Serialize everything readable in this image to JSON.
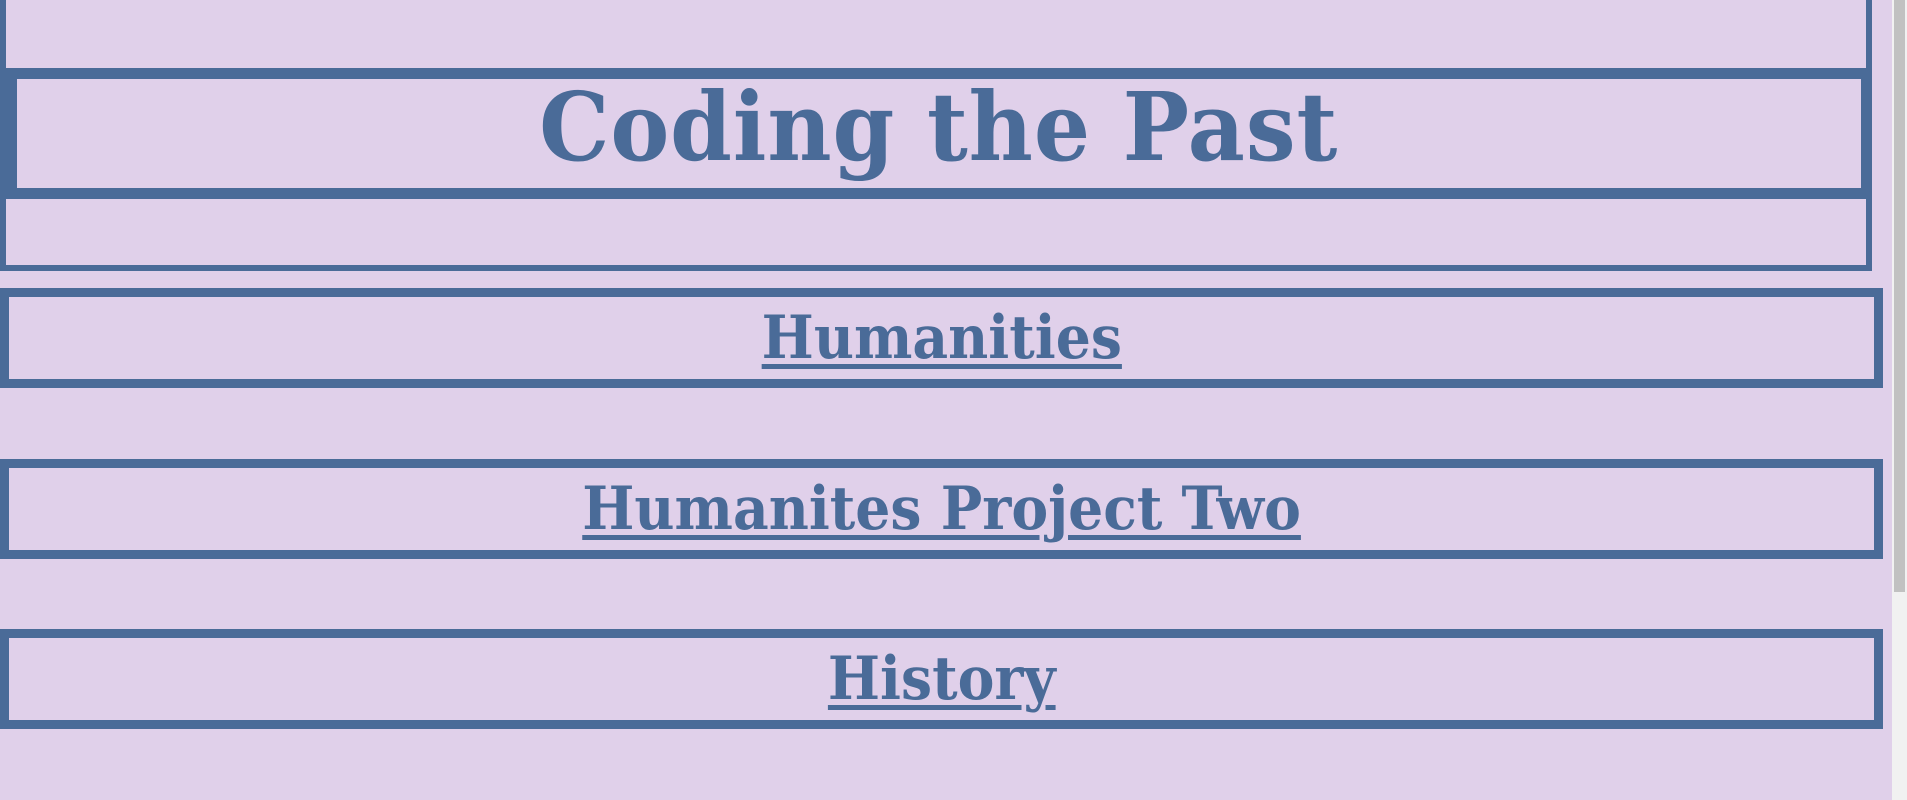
{
  "header": {
    "title": "Coding the Past"
  },
  "nav": {
    "items": [
      {
        "label": "Humanities"
      },
      {
        "label": "Humanites Project Two"
      },
      {
        "label": "History"
      }
    ]
  },
  "colors": {
    "background": "#e0d0ea",
    "accent": "#4a6b98",
    "scrollbar_track": "#f1f1f1",
    "scrollbar_thumb": "#c1c1c1"
  }
}
